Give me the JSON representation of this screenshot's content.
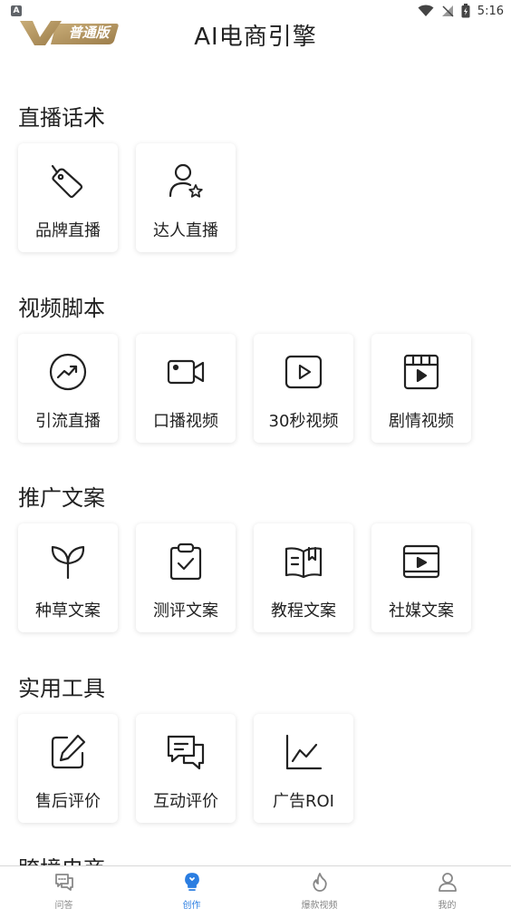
{
  "status_bar": {
    "time": "5:16",
    "left_icon": "A"
  },
  "header": {
    "badge_text": "普通版",
    "title": "AI电商引擎"
  },
  "sections": [
    {
      "title": "直播话术",
      "items": [
        {
          "label": "品牌直播",
          "icon": "tag-icon"
        },
        {
          "label": "达人直播",
          "icon": "user-star-icon"
        }
      ]
    },
    {
      "title": "视频脚本",
      "items": [
        {
          "label": "引流直播",
          "icon": "trend-up-icon"
        },
        {
          "label": "口播视频",
          "icon": "video-camera-icon"
        },
        {
          "label": "30秒视频",
          "icon": "play-box-icon"
        },
        {
          "label": "剧情视频",
          "icon": "clapper-icon"
        }
      ]
    },
    {
      "title": "推广文案",
      "items": [
        {
          "label": "种草文案",
          "icon": "sprout-icon"
        },
        {
          "label": "测评文案",
          "icon": "clipboard-check-icon"
        },
        {
          "label": "教程文案",
          "icon": "book-icon"
        },
        {
          "label": "社媒文案",
          "icon": "media-player-icon"
        }
      ]
    },
    {
      "title": "实用工具",
      "items": [
        {
          "label": "售后评价",
          "icon": "edit-icon"
        },
        {
          "label": "互动评价",
          "icon": "chat-icon"
        },
        {
          "label": "广告ROI",
          "icon": "line-chart-icon"
        }
      ]
    }
  ],
  "cutoff_section_title": "跨境电商",
  "bottom_nav": [
    {
      "label": "问答",
      "icon": "chat-bubbles-icon"
    },
    {
      "label": "创作",
      "icon": "bulb-icon",
      "active": true
    },
    {
      "label": "爆款视频",
      "icon": "flame-icon"
    },
    {
      "label": "我的",
      "icon": "person-icon"
    }
  ],
  "colors": {
    "accent": "#2a7de1",
    "badge_gold": "#b89a63",
    "text": "#222222"
  }
}
